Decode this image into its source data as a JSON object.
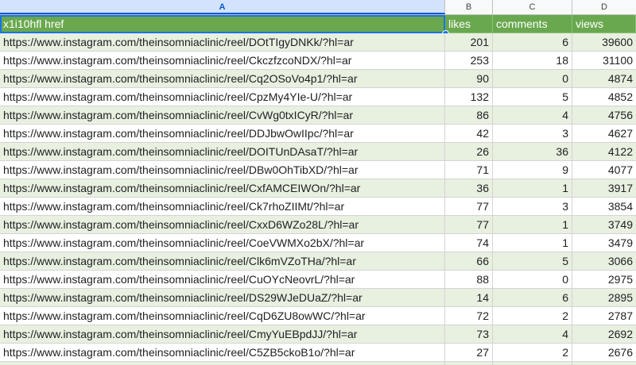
{
  "columns": {
    "a": "A",
    "b": "B",
    "c": "C",
    "d": "D"
  },
  "header": {
    "a": "x1i10hfl href",
    "b": "likes",
    "c": "comments",
    "d": "views"
  },
  "rows": [
    {
      "url": "https://www.instagram.com/theinsomniaclinic/reel/DOtTIgyDNKk/?hl=ar",
      "likes": "201",
      "comments": "6",
      "views": "39600"
    },
    {
      "url": "https://www.instagram.com/theinsomniaclinic/reel/CkczfzcoNDX/?hl=ar",
      "likes": "253",
      "comments": "18",
      "views": "31100"
    },
    {
      "url": "https://www.instagram.com/theinsomniaclinic/reel/Cq2OSoVo4p1/?hl=ar",
      "likes": "90",
      "comments": "0",
      "views": "4874"
    },
    {
      "url": "https://www.instagram.com/theinsomniaclinic/reel/CpzMy4YIe-U/?hl=ar",
      "likes": "132",
      "comments": "5",
      "views": "4852"
    },
    {
      "url": "https://www.instagram.com/theinsomniaclinic/reel/CvWg0txICyR/?hl=ar",
      "likes": "86",
      "comments": "4",
      "views": "4756"
    },
    {
      "url": "https://www.instagram.com/theinsomniaclinic/reel/DDJbwOwIIpc/?hl=ar",
      "likes": "42",
      "comments": "3",
      "views": "4627"
    },
    {
      "url": "https://www.instagram.com/theinsomniaclinic/reel/DOITUnDAsaT/?hl=ar",
      "likes": "26",
      "comments": "36",
      "views": "4122"
    },
    {
      "url": "https://www.instagram.com/theinsomniaclinic/reel/DBw0OhTibXD/?hl=ar",
      "likes": "71",
      "comments": "9",
      "views": "4077"
    },
    {
      "url": "https://www.instagram.com/theinsomniaclinic/reel/CxfAMCEIWOn/?hl=ar",
      "likes": "36",
      "comments": "1",
      "views": "3917"
    },
    {
      "url": "https://www.instagram.com/theinsomniaclinic/reel/Ck7rhoZIIMt/?hl=ar",
      "likes": "77",
      "comments": "3",
      "views": "3854"
    },
    {
      "url": "https://www.instagram.com/theinsomniaclinic/reel/CxxD6WZo28L/?hl=ar",
      "likes": "77",
      "comments": "1",
      "views": "3749"
    },
    {
      "url": "https://www.instagram.com/theinsomniaclinic/reel/CoeVWMXo2bX/?hl=ar",
      "likes": "74",
      "comments": "1",
      "views": "3479"
    },
    {
      "url": "https://www.instagram.com/theinsomniaclinic/reel/Clk6mVZoTHa/?hl=ar",
      "likes": "66",
      "comments": "5",
      "views": "3066"
    },
    {
      "url": "https://www.instagram.com/theinsomniaclinic/reel/CuOYcNeovrL/?hl=ar",
      "likes": "88",
      "comments": "0",
      "views": "2975"
    },
    {
      "url": "https://www.instagram.com/theinsomniaclinic/reel/DS29WJeDUaZ/?hl=ar",
      "likes": "14",
      "comments": "6",
      "views": "2895"
    },
    {
      "url": "https://www.instagram.com/theinsomniaclinic/reel/CqD6ZU8owWC/?hl=ar",
      "likes": "72",
      "comments": "2",
      "views": "2787"
    },
    {
      "url": "https://www.instagram.com/theinsomniaclinic/reel/CmyYuEBpdJJ/?hl=ar",
      "likes": "73",
      "comments": "4",
      "views": "2692"
    },
    {
      "url": "https://www.instagram.com/theinsomniaclinic/reel/C5ZB5ckoB1o/?hl=ar",
      "likes": "27",
      "comments": "2",
      "views": "2676"
    },
    {
      "url": "https://www.instagram.com/theinsomniaclinic/reel/CsrVNP4IatG/?hl=ar",
      "likes": "69",
      "comments": "9",
      "views": "2668"
    }
  ],
  "colors": {
    "header_bg": "#6aa84f",
    "band_bg": "#e8f0e0",
    "selection": "#1a73e8"
  }
}
